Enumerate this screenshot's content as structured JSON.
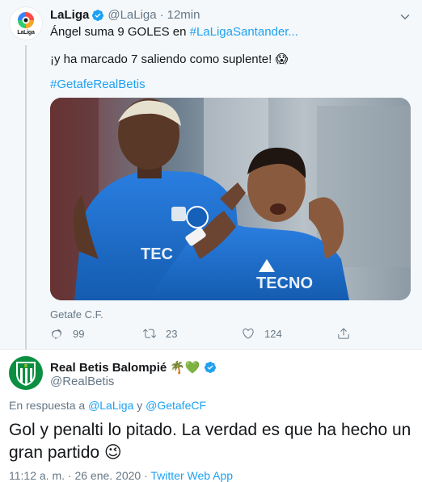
{
  "tweet1": {
    "author_name": "LaLiga",
    "handle": "@LaLiga",
    "separator": "·",
    "time": "12min",
    "text_line1_prefix": "Ángel suma 9 GOLES en ",
    "text_line1_hashtag": "#LaLigaSantander...",
    "text_line2": "¡y ha marcado 7 saliendo como suplente! 😱",
    "hashtag": "#GetafeRealBetis",
    "media_caption": "Getafe C.F.",
    "actions": {
      "replies": "99",
      "retweets": "23",
      "likes": "124"
    },
    "avatar_text": "LaLiga"
  },
  "tweet2": {
    "author_name": "Real Betis Balompié",
    "name_emojis": "🌴💚",
    "handle": "@RealBetis",
    "reply_prefix": "En respuesta a ",
    "reply_user1": "@LaLiga",
    "reply_and": " y ",
    "reply_user2": "@GetafeCF",
    "text": "Gol y penalti lo pitado. La verdad es que ha hecho un gran partido 😉",
    "timestamp": "11:12 a. m. · 26 ene. 2020 · ",
    "source": "Twitter Web App"
  },
  "colors": {
    "link": "#1da1f2",
    "secondary_text": "#657786",
    "thread_bg": "#f5f8fa",
    "verified": "#1da1f2",
    "getafe_blue": "#1a6fd0",
    "betis_green": "#0b8f41"
  },
  "icons": [
    "laliga-logo-icon",
    "verified-icon",
    "caret-down-icon",
    "reply-icon",
    "retweet-icon",
    "like-icon",
    "share-icon",
    "betis-crest-icon"
  ]
}
